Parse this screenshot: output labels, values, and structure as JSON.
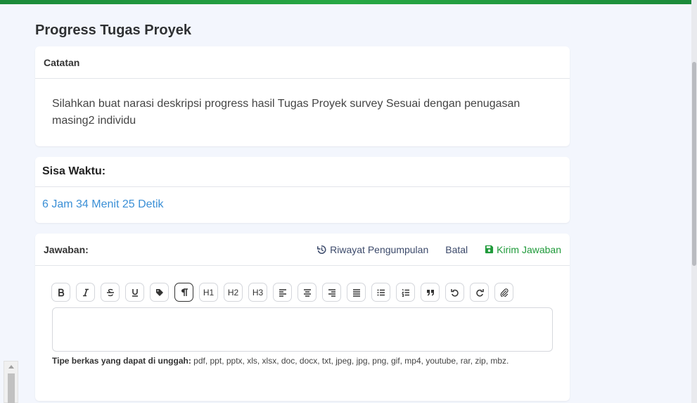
{
  "page": {
    "title": "Progress Tugas Proyek"
  },
  "notes": {
    "header": "Catatan",
    "body": "Silahkan buat narasi deskripsi progress hasil Tugas Proyek survey Sesuai dengan penugasan masing2 individu"
  },
  "timer": {
    "header": "Sisa Waktu:",
    "value": "6 Jam 34 Menit 25 Detik",
    "color": "#3a8fd6"
  },
  "answer": {
    "header": "Jawaban:",
    "history_label": "Riwayat Pengumpulan",
    "cancel_label": "Batal",
    "submit_label": "Kirim Jawaban",
    "submit_color": "#1f9a3a",
    "toolbar": {
      "h1": "H1",
      "h2": "H2",
      "h3": "H3"
    },
    "filetypes_label": "Tipe berkas yang dapat di unggah:",
    "filetypes_list": "pdf, ppt, pptx, xls, xlsx, doc, docx, txt, jpeg, jpg, png, gif, mp4, youtube, rar, zip, mbz."
  },
  "colors": {
    "top_bar": "#1b8a3a",
    "background": "#f3f6fd"
  }
}
